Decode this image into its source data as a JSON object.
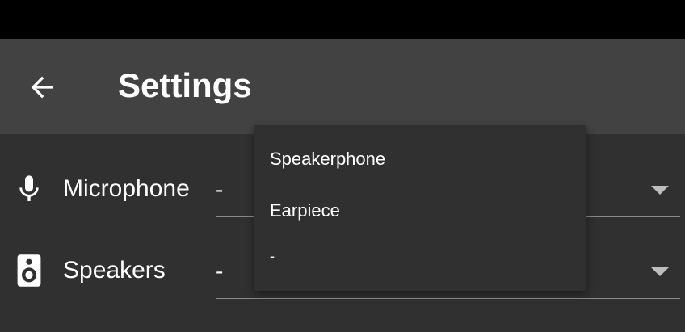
{
  "app_bar": {
    "title": "Settings",
    "back_icon": "arrow-back-icon"
  },
  "settings": {
    "microphone": {
      "label": "Microphone",
      "icon": "microphone-icon",
      "value": "-"
    },
    "speakers": {
      "label": "Speakers",
      "icon": "speaker-icon",
      "value": "-"
    }
  },
  "dropdown": {
    "options": [
      "Speakerphone",
      "Earpiece",
      "-"
    ]
  },
  "colors": {
    "status_bar": "#000000",
    "app_bar": "#424242",
    "background": "#303030",
    "text": "#ffffff",
    "underline": "#8a8a8a"
  }
}
